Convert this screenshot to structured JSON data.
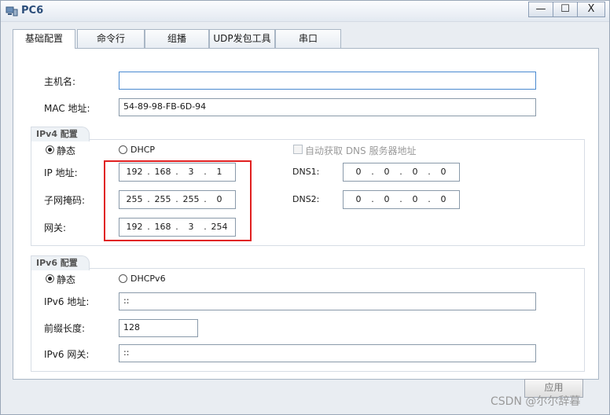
{
  "window": {
    "title": "PC6",
    "min_glyph": "—",
    "max_glyph": "☐",
    "close_glyph": "X"
  },
  "tabs": [
    {
      "label": "基础配置",
      "active": true
    },
    {
      "label": "命令行",
      "active": false
    },
    {
      "label": "组播",
      "active": false
    },
    {
      "label": "UDP发包工具",
      "active": false
    },
    {
      "label": "串口",
      "active": false
    }
  ],
  "basic": {
    "hostname_label": "主机名:",
    "hostname_value": "",
    "mac_label": "MAC 地址:",
    "mac_value": "54-89-98-FB-6D-94"
  },
  "ipv4": {
    "group_title": "IPv4 配置",
    "static_label": "静态",
    "dhcp_label": "DHCP",
    "mode": "static",
    "auto_dns_label": "自动获取 DNS 服务器地址",
    "ip_label": "IP 地址:",
    "ip": [
      "192",
      "168",
      "3",
      "1"
    ],
    "mask_label": "子网掩码:",
    "mask": [
      "255",
      "255",
      "255",
      "0"
    ],
    "gateway_label": "网关:",
    "gateway": [
      "192",
      "168",
      "3",
      "254"
    ],
    "dns1_label": "DNS1:",
    "dns1": [
      "0",
      "0",
      "0",
      "0"
    ],
    "dns2_label": "DNS2:",
    "dns2": [
      "0",
      "0",
      "0",
      "0"
    ]
  },
  "ipv6": {
    "group_title": "IPv6 配置",
    "static_label": "静态",
    "dhcp_label": "DHCPv6",
    "mode": "static",
    "addr_label": "IPv6 地址:",
    "addr_value": "::",
    "prefix_label": "前缀长度:",
    "prefix_value": "128",
    "gateway_label": "IPv6 网关:",
    "gateway_value": "::"
  },
  "apply_label": "应用",
  "watermark": "CSDN @尔尔辞暮",
  "colors": {
    "highlight": "#e02020",
    "title": "#2b4d7a"
  }
}
